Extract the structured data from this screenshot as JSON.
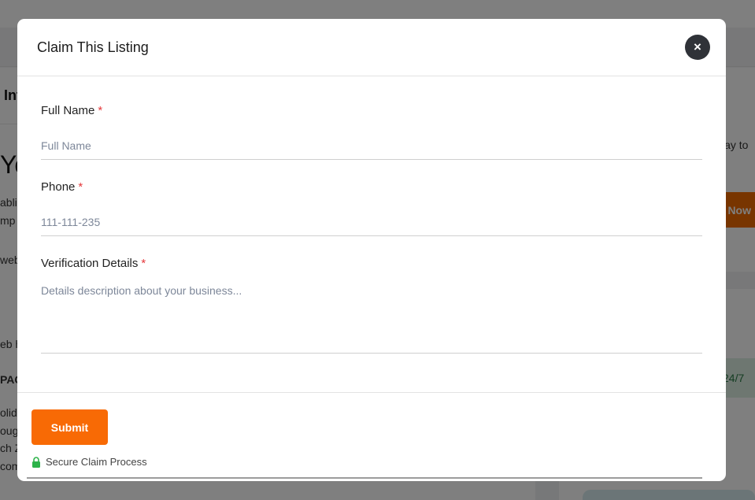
{
  "background": {
    "fragments": {
      "tab_text": "Int",
      "heading_fragment": "Yo",
      "text_1": "ablis",
      "text_2": "mp",
      "text_3": "web",
      "text_4": "eb h",
      "text_5": "PAC",
      "text_6": "olid",
      "text_7": "oug",
      "text_8": "ch Z",
      "text_9": "com",
      "right_text_1": "way to",
      "right_button": "n Now",
      "right_badge": "24/7"
    }
  },
  "modal": {
    "title": "Claim This Listing",
    "close_label": "×",
    "fields": {
      "full_name": {
        "label": "Full Name",
        "required_mark": "*",
        "value": "",
        "placeholder": "Full Name"
      },
      "phone": {
        "label": "Phone",
        "required_mark": "*",
        "value": "",
        "placeholder": "111-111-235"
      },
      "verification": {
        "label": "Verification Details",
        "required_mark": "*",
        "value": "",
        "placeholder": "Details description about your business..."
      }
    },
    "submit_label": "Submit",
    "secure_text": "Secure Claim Process",
    "icons": {
      "close": "close-icon",
      "secure": "lock-icon"
    },
    "colors": {
      "accent": "#f86a05",
      "required": "#e5383b",
      "secure_icon": "#2db34a",
      "close_bg": "#2f3238"
    }
  }
}
